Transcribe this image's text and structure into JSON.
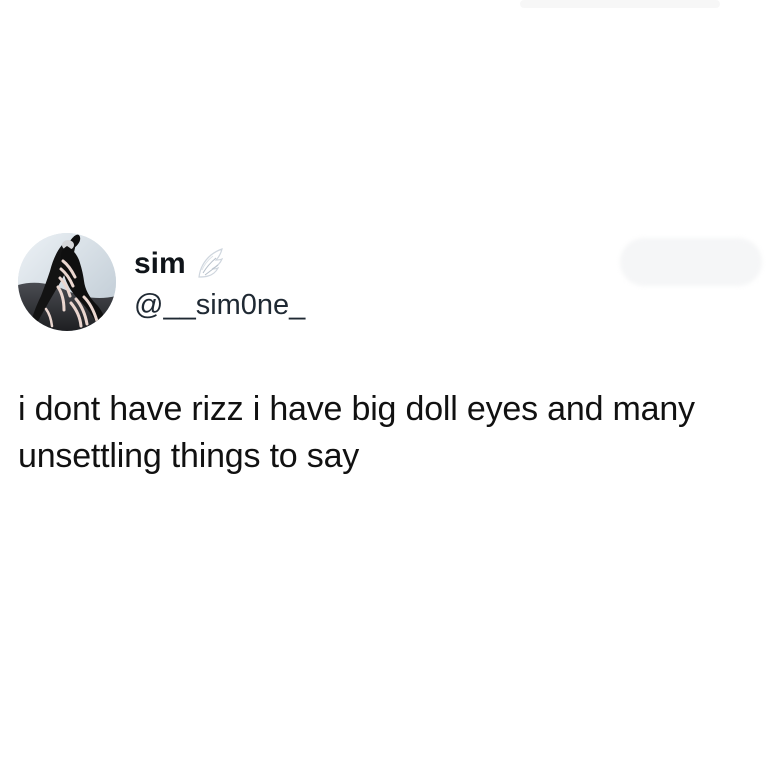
{
  "tweet": {
    "author": {
      "display_name": "sim",
      "handle": "@__sim0ne_",
      "avatar_icon": "profile-photo-icon",
      "badge_icon": "angel-wing-icon"
    },
    "text": "i dont have rizz i have big doll eyes and many unsettling things to say"
  },
  "colors": {
    "background": "#ffffff",
    "text_primary": "#0f1419",
    "text_secondary": "#1f2933",
    "ghost_ui": "#f5f6f7"
  }
}
